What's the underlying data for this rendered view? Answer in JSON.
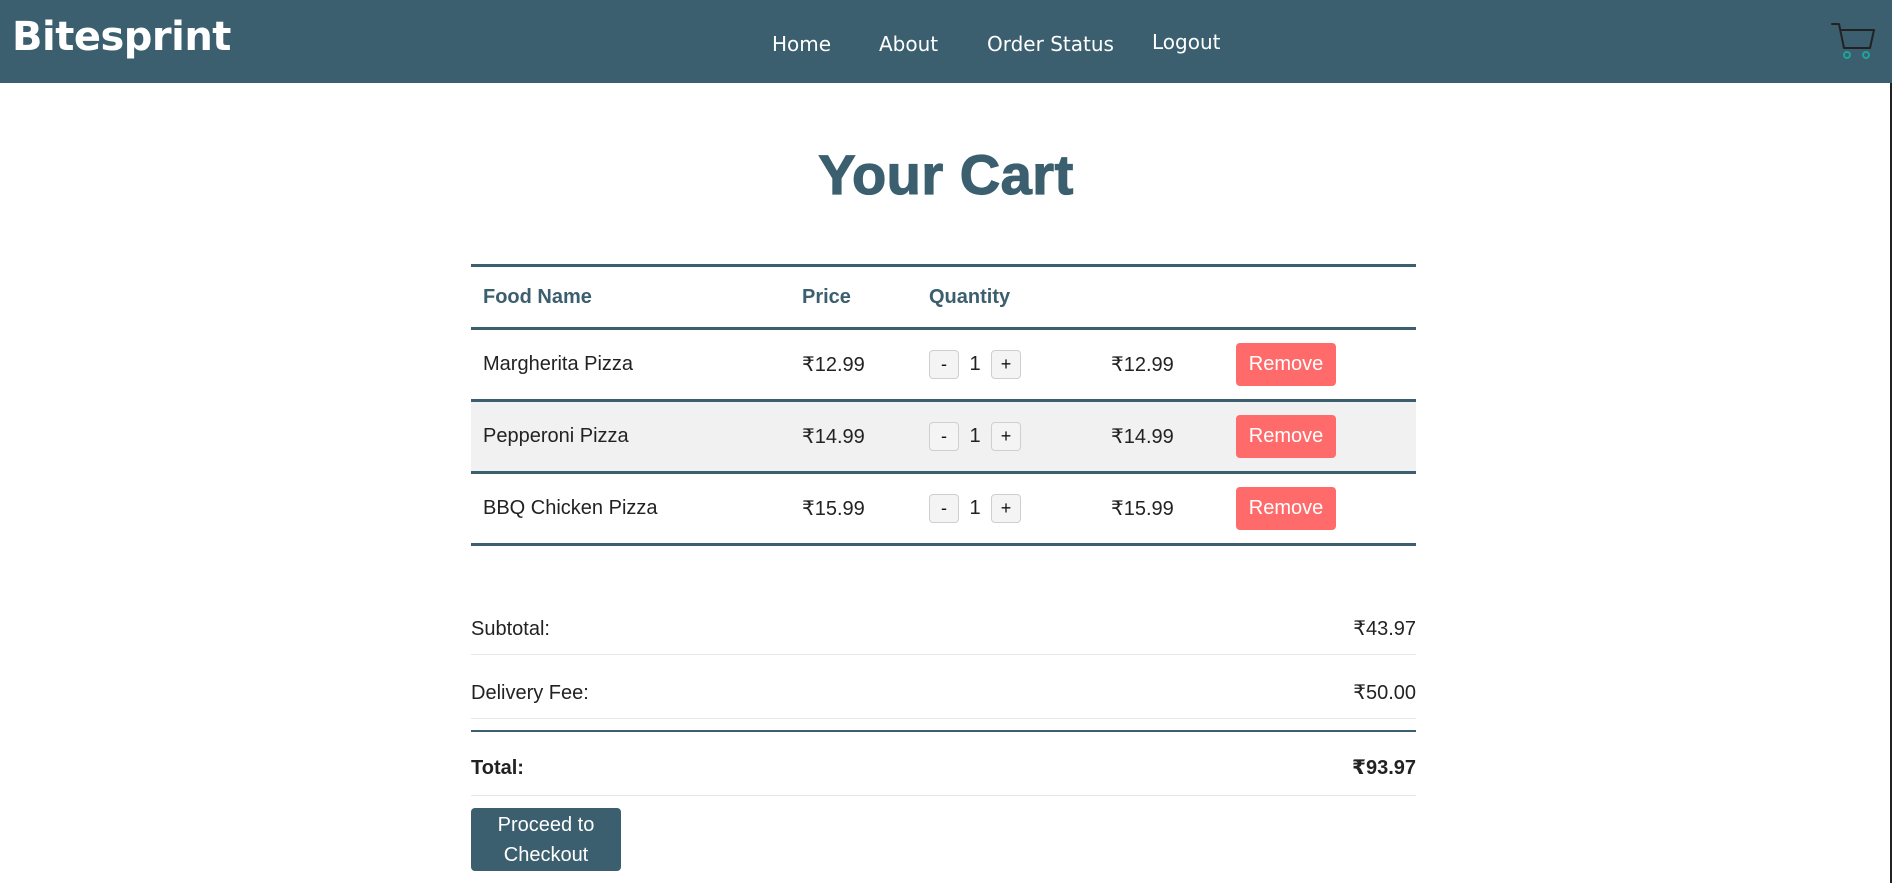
{
  "header": {
    "brand": "Bitesprint",
    "nav": [
      "Home",
      "About",
      "Order Status",
      "Logout"
    ],
    "cart_icon": "shopping-cart-icon"
  },
  "page_title": "Your Cart",
  "table": {
    "columns": [
      "Food Name",
      "Price",
      "Quantity"
    ],
    "rows": [
      {
        "name": "Margherita Pizza",
        "price": "₹12.99",
        "qty_minus": "-",
        "qty": "1",
        "qty_plus": "+",
        "total": "₹12.99",
        "action": "Remove"
      },
      {
        "name": "Pepperoni Pizza",
        "price": "₹14.99",
        "qty_minus": "-",
        "qty": "1",
        "qty_plus": "+",
        "total": "₹14.99",
        "action": "Remove"
      },
      {
        "name": "BBQ Chicken Pizza",
        "price": "₹15.99",
        "qty_minus": "-",
        "qty": "1",
        "qty_plus": "+",
        "total": "₹15.99",
        "action": "Remove"
      }
    ]
  },
  "summary": {
    "subtotal_label": "Subtotal:",
    "subtotal_value": "₹43.97",
    "delivery_label": "Delivery Fee:",
    "delivery_value": "₹50.00",
    "total_label": "Total:",
    "total_value": "₹93.97"
  },
  "checkout": {
    "line1": "Proceed to",
    "line2": "Checkout"
  },
  "colors": {
    "primary": "#3b5f6e",
    "remove": "#ff6b6b",
    "row_alt": "#f1f1f1"
  }
}
